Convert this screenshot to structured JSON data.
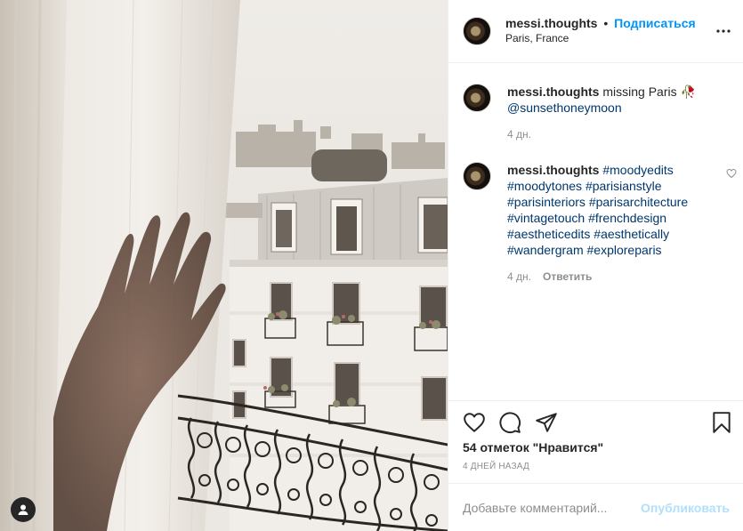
{
  "header": {
    "username": "messi.thoughts",
    "separator": "•",
    "follow_label": "Подписаться",
    "location": "Paris, France",
    "more_icon": "more-horizontal-icon"
  },
  "comments": [
    {
      "username": "messi.thoughts",
      "text": " missing Paris 🥀",
      "mention": "@sunsethoneymoon",
      "time": "4 дн."
    },
    {
      "username": "messi.thoughts",
      "hashtags": [
        "#moodyedits",
        "#moodytones",
        "#parisianstyle",
        "#parisinteriors",
        "#parisarchitecture",
        "#vintagetouch",
        "#frenchdesign",
        "#aestheticedits",
        "#aesthetically",
        "#wandergram",
        "#exploreparis"
      ],
      "time": "4 дн.",
      "reply_label": "Ответить",
      "like_icon": "heart-outline-icon"
    }
  ],
  "actions": {
    "like_icon": "heart-icon",
    "comment_icon": "comment-bubble-icon",
    "share_icon": "paper-plane-icon",
    "save_icon": "bookmark-icon"
  },
  "likes_text": "54 отметок \"Нравится\"",
  "date_text": "4 ДНЕЙ НАЗАД",
  "add_comment": {
    "placeholder": "Добавьте комментарий...",
    "value": "",
    "publish_label": "Опубликовать"
  },
  "photo": {
    "user_tag_icon": "user-tag-icon"
  },
  "colors": {
    "link_blue": "#0095f6",
    "publish_disabled": "#b2dffc",
    "tag_dark_blue": "#00376b",
    "muted": "#8e8e8e"
  }
}
